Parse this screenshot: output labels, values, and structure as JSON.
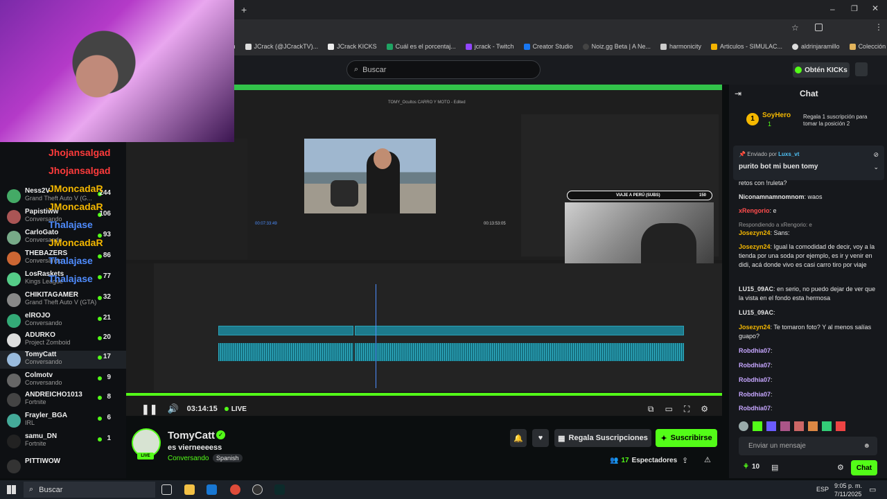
{
  "browser": {
    "bookmarks": [
      "ch",
      "JCrack (@JCrackTV)...",
      "JCrack KICKS",
      "Cuál es el porcentaj...",
      "jcrack - Twitch",
      "Creator Studio",
      "Noiz.gg Beta | A Ne...",
      "harmonicity",
      "Articulos - SIMULAC...",
      "aldrinjaramillo",
      "Colección de M_blei..."
    ]
  },
  "header": {
    "search_placeholder": "Buscar",
    "get_kicks": "Obtén KICKs"
  },
  "sidebar": {
    "items": [
      {
        "name": "Ness2V",
        "category": "Grand Theft Auto V (G...",
        "count": "244"
      },
      {
        "name": "Papistiww",
        "category": "Conversando",
        "count": "106"
      },
      {
        "name": "CarloGato",
        "category": "Conversando",
        "count": "93"
      },
      {
        "name": "THEBAZERS",
        "category": "Conversando",
        "count": "86"
      },
      {
        "name": "LosRaskets",
        "category": "Kings League",
        "count": "77"
      },
      {
        "name": "CHIKITAGAMER",
        "category": "Grand Theft Auto V (GTA)",
        "count": "32"
      },
      {
        "name": "elROJO",
        "category": "Conversando",
        "count": "21"
      },
      {
        "name": "ADURKO",
        "category": "Project Zomboid",
        "count": "20"
      },
      {
        "name": "TomyCatt",
        "category": "Conversando",
        "count": "17"
      },
      {
        "name": "Colmotv",
        "category": "Conversando",
        "count": "9"
      },
      {
        "name": "ANDREICHO1013",
        "category": "Fortnite",
        "count": "8"
      },
      {
        "name": "Frayler_BGA",
        "category": "IRL",
        "count": "6"
      },
      {
        "name": "samu_DN",
        "category": "Fortnite",
        "count": "1"
      },
      {
        "name": "PITTIWOW",
        "category": "",
        "count": ""
      }
    ],
    "overlay_names": [
      "Jhojansalgad",
      "Jhojansalgad",
      "JMoncadaR",
      "JMoncadaR",
      "Thalajase",
      "JMoncadaR",
      "Thalajase",
      "Thalajase"
    ]
  },
  "video": {
    "premiere_title": "TOMY_Ocultos CARRO Y MOTO - Edited",
    "overlay_bar": "VIAJE A PERÚ (SUBS)",
    "overlay_bar_count": "150",
    "timecode_left": "00:07:33:49",
    "timecode_right": "00:13:53:05",
    "elapsed": "03:14:15",
    "live_label": "LIVE",
    "progress": 1.0
  },
  "channel": {
    "name": "TomyCatt",
    "title": "es vierneeeess",
    "category": "Conversando",
    "language": "Spanish",
    "live_badge": "LIVE",
    "viewers": "17",
    "viewers_label": "Espectadores",
    "gift_button": "Regala Suscripciones",
    "subscribe_button": "Suscribirse"
  },
  "chat": {
    "title": "Chat",
    "top_gifter": "SoyHero",
    "top_gifter_count": "1",
    "gift_prompt": "Regala 1 suscripción para tomar la posición 2",
    "pinned_by_label": "Enviado por",
    "pinned_by": "Luxs_vt",
    "pinned_message": "purito bot mi buen tomy",
    "messages": [
      {
        "user": "",
        "text": "retos con !ruleta?"
      },
      {
        "user": "Niconamnamnomnom",
        "text": "waos"
      },
      {
        "user": "xRengorio",
        "text": "e"
      },
      {
        "user": "",
        "text": "Respondiendo a xRengorio: e"
      },
      {
        "user": "Josezyn24",
        "text": "Sans:"
      },
      {
        "user": "Josezyn24",
        "text": "Igual la comodidad de decir, voy a la tienda por una soda por ejemplo, es ir y venir en didi, acá donde vivo es casi carro tiro por viaje"
      },
      {
        "user": "LU15_09AC",
        "text": "en serio, no puedo dejar de ver que la vista en el fondo esta hermosa"
      },
      {
        "user": "LU15_09AC",
        "text": ""
      },
      {
        "user": "Josezyn24",
        "text": "Te tomaron foto? Y al menos salías guapo?"
      },
      {
        "user": "Robdhia07",
        "text": ""
      },
      {
        "user": "Robdhia07",
        "text": ""
      },
      {
        "user": "Robdhia07",
        "text": ""
      },
      {
        "user": "Robdhia07",
        "text": ""
      },
      {
        "user": "Robdhia07",
        "text": ""
      }
    ],
    "input_placeholder": "Enviar un mensaje",
    "points": "10",
    "send_button": "Chat"
  },
  "taskbar": {
    "search_label": "Buscar",
    "lang": "ESP",
    "time": "9:05 p. m.",
    "date": "7/11/2025"
  },
  "colors": {
    "accent": "#53fc18",
    "bg": "#0b0e0f"
  }
}
